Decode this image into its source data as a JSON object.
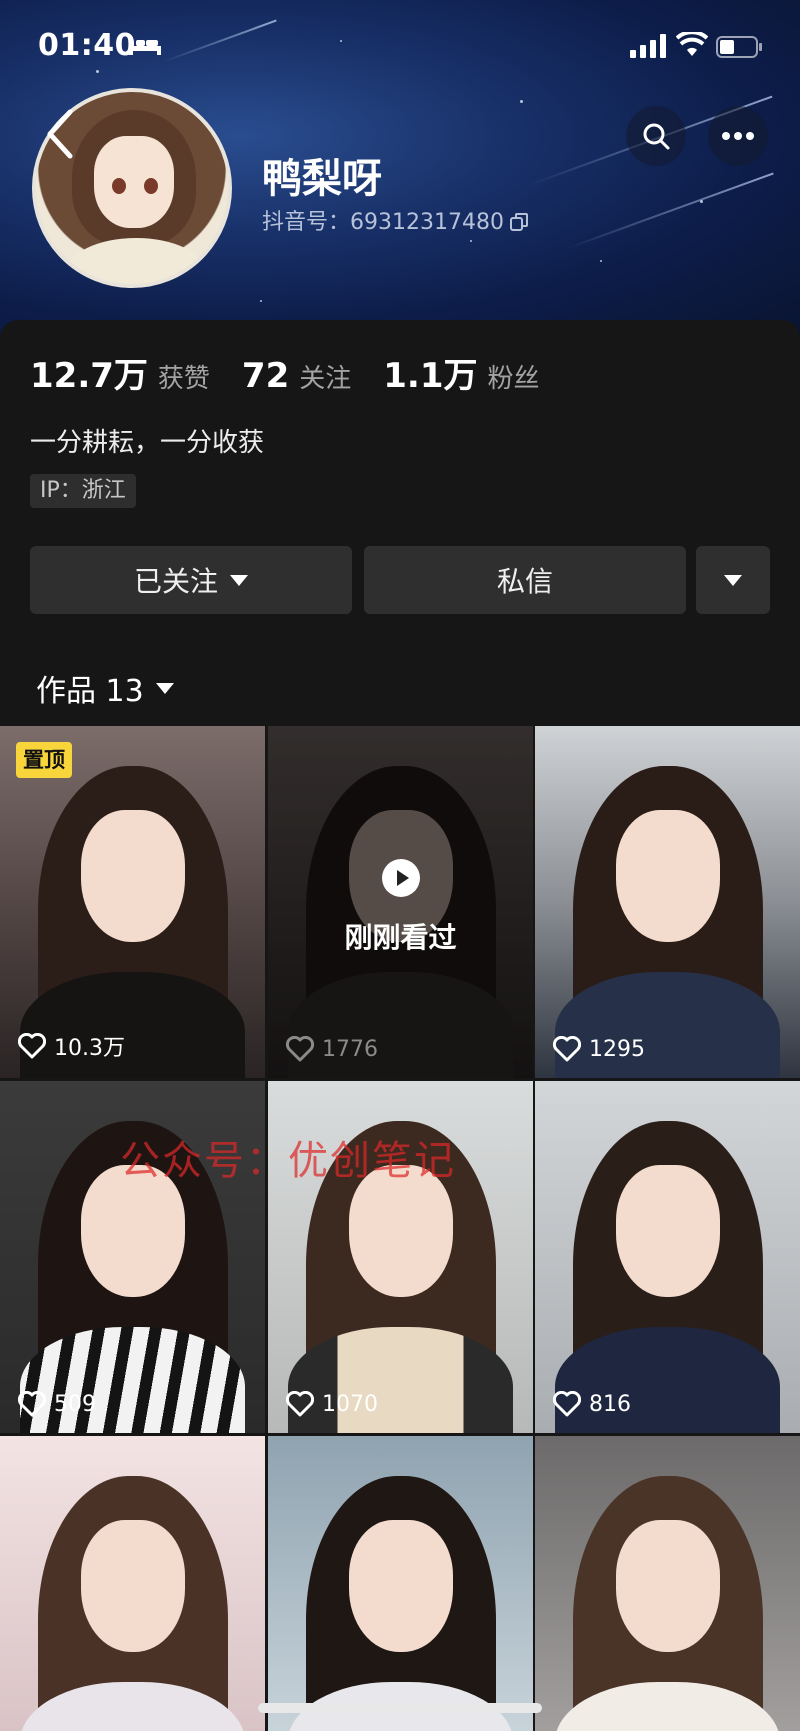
{
  "status_bar": {
    "time": "01:40"
  },
  "profile": {
    "name": "鸭梨呀",
    "douyin_id": "抖音号：69312317480"
  },
  "stats": [
    {
      "value": "12.7万",
      "label": "获赞"
    },
    {
      "value": "72",
      "label": "关注"
    },
    {
      "value": "1.1万",
      "label": "粉丝"
    }
  ],
  "bio": "一分耕耘，一分收获",
  "ip": "IP：浙江",
  "actions": {
    "followed": "已关注",
    "message": "私信"
  },
  "works": {
    "label": "作品 13"
  },
  "grid": [
    {
      "likes": "10.3万",
      "badge": "置顶"
    },
    {
      "likes": "1776",
      "overlay": "刚刚看过"
    },
    {
      "likes": "1295"
    },
    {
      "likes": "509"
    },
    {
      "likes": "1070"
    },
    {
      "likes": "816"
    },
    {
      "likes": ""
    },
    {
      "likes": ""
    },
    {
      "likes": ""
    }
  ],
  "watermark": "公众号：优创笔记",
  "icons": [
    "bed-icon",
    "signal-icon",
    "wifi-icon",
    "battery-icon",
    "back-icon",
    "search-icon",
    "more-icon",
    "copy-icon",
    "caret-down-icon",
    "heart-icon",
    "play-icon"
  ],
  "colors": {
    "background": "#161616",
    "button": "#2f2f2f",
    "pin_badge": "#f9d53c",
    "header_blue": "#183068"
  }
}
